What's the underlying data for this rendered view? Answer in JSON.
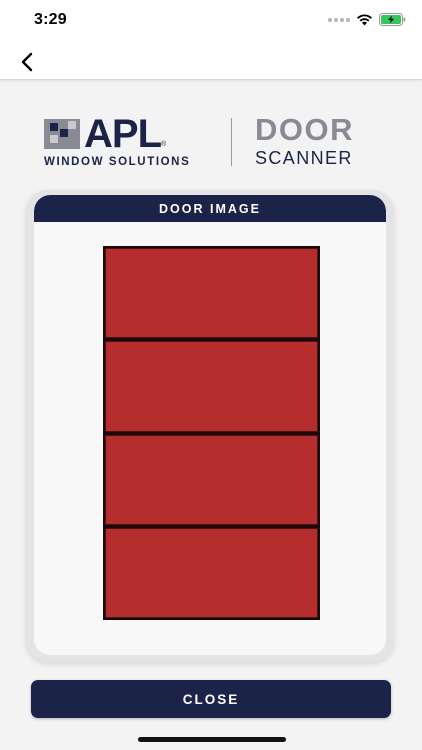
{
  "status_bar": {
    "time": "3:29",
    "icons": [
      "signal-dots-icon",
      "wifi-icon",
      "battery-charging-icon"
    ],
    "battery_color": "#34c759"
  },
  "nav": {
    "back_icon": "chevron-left-icon"
  },
  "logo": {
    "brand": "APL",
    "brand_registered": "®",
    "brand_subtitle": "WINDOW SOLUTIONS",
    "product_line1": "DOOR",
    "product_line2": "SCANNER"
  },
  "card": {
    "title": "DOOR IMAGE",
    "door_panels": 4,
    "door_color": "#b52d2d"
  },
  "actions": {
    "close_label": "CLOSE"
  },
  "colors": {
    "navy": "#1c2348",
    "gray_text": "#8a8a94",
    "background": "#f3f3f4"
  }
}
